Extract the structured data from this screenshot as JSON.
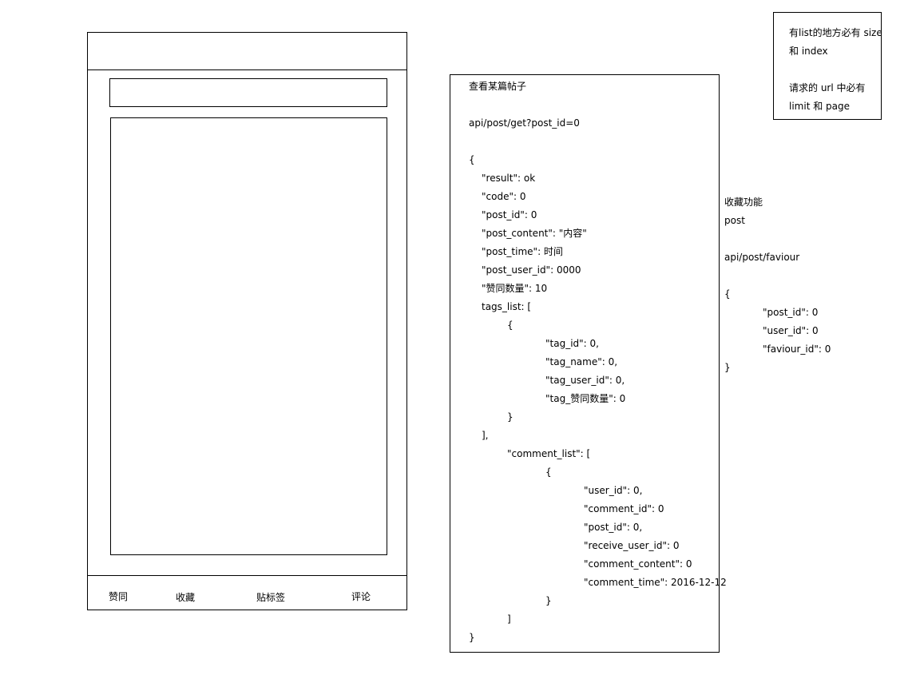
{
  "mockup": {
    "actions": {
      "like": "赞同",
      "favorite": "收藏",
      "tag": "贴标签",
      "comment": "评论"
    }
  },
  "api_get_post": {
    "lines": [
      "查看某篇帖子",
      "",
      "api/post/get?post_id=0",
      "",
      "{",
      "\"result\": ok",
      "\"code\": 0",
      "\"post_id\": 0",
      "\"post_content\": \"内容\"",
      "\"post_time\": 时间",
      "\"post_user_id\": 0000",
      "\"赞同数量\": 10",
      "tags_list: [",
      "{",
      "\"tag_id\": 0,",
      "\"tag_name\": 0,",
      "\"tag_user_id\": 0,",
      "\"tag_赞同数量\": 0",
      "}",
      "],",
      "\"comment_list\": [",
      "{",
      "\"user_id\": 0,",
      "\"comment_id\": 0",
      "\"post_id\": 0,",
      "\"receive_user_id\": 0",
      "\"comment_content\": 0",
      "\"comment_time\": 2016-12-12",
      "}",
      "]",
      "}"
    ]
  },
  "api_favourite": {
    "lines": [
      "收藏功能",
      "post",
      "",
      "api/post/faviour",
      "",
      "{",
      "\"post_id\": 0",
      "\"user_id\": 0",
      "\"faviour_id\": 0",
      "}"
    ]
  },
  "note": {
    "lines": [
      "有list的地方必有 size",
      "和 index",
      "",
      "请求的 url 中必有",
      "limit 和 page"
    ]
  }
}
